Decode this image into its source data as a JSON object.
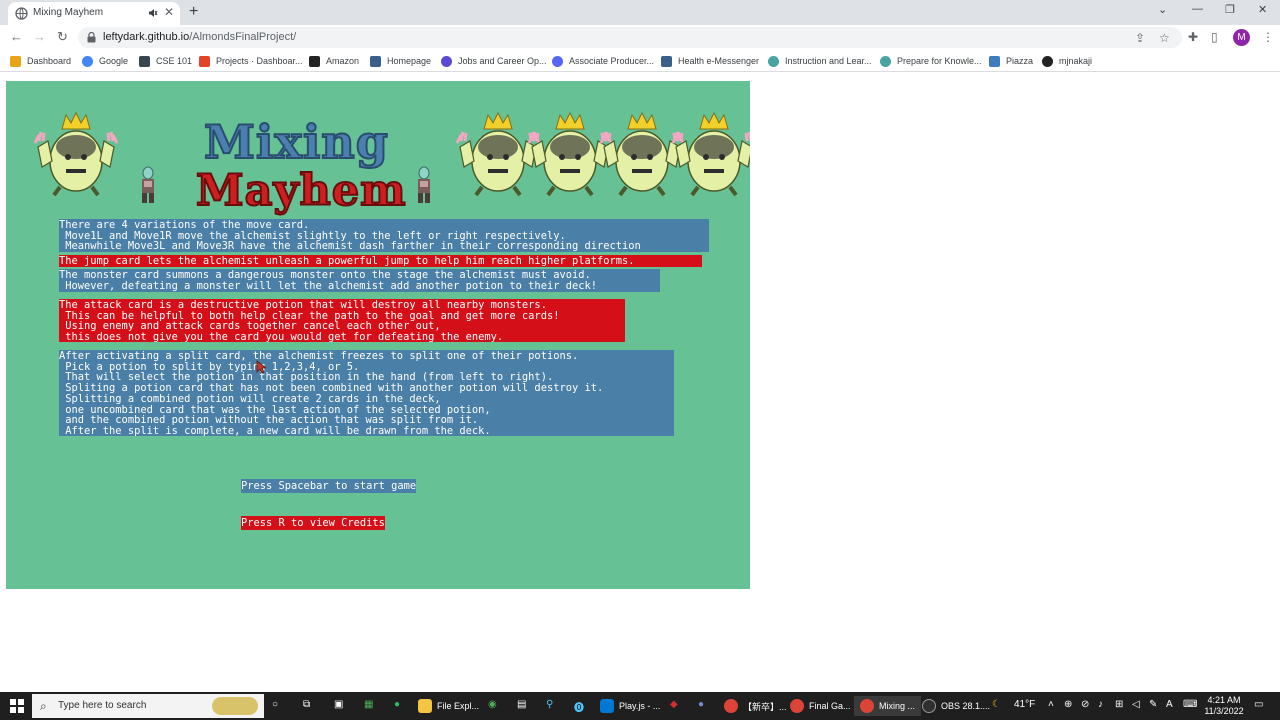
{
  "tab": {
    "title": "Mixing Mayhem",
    "close": "✕"
  },
  "newtab": "+",
  "window_controls": {
    "dropdown": "⌄",
    "minimize": "—",
    "maximize": "❐",
    "close": "✕"
  },
  "address": {
    "domain": "leftydark.github.io",
    "path": "/AlmondsFinalProject/"
  },
  "bookmarks": [
    {
      "label": "Dashboard",
      "icon": "canvas-icon",
      "color": "#e8a316"
    },
    {
      "label": "Google",
      "icon": "google-icon",
      "color": "#4285f4"
    },
    {
      "label": "CSE 101",
      "icon": "cse-icon",
      "color": "#37474f"
    },
    {
      "label": "Projects · Dashboar...",
      "icon": "gitlab-icon",
      "color": "#e24329"
    },
    {
      "label": "Amazon",
      "icon": "amazon-icon",
      "color": "#222222"
    },
    {
      "label": "Homepage",
      "icon": "homepage-icon",
      "color": "#3a5f8a"
    },
    {
      "label": "Jobs and Career Op...",
      "icon": "handshake-icon",
      "color": "#5b4ad6"
    },
    {
      "label": "Associate Producer...",
      "icon": "discord-icon",
      "color": "#5865f2"
    },
    {
      "label": "Health e-Messenger",
      "icon": "health-icon",
      "color": "#3a5f8a"
    },
    {
      "label": "Instruction and Lear...",
      "icon": "globe-icon",
      "color": "#4aa3a3"
    },
    {
      "label": "Prepare for Knowle...",
      "icon": "globe-icon",
      "color": "#4aa3a3"
    },
    {
      "label": "Piazza",
      "icon": "piazza-icon",
      "color": "#3e7bbf"
    },
    {
      "label": "mjnakaji",
      "icon": "github-icon",
      "color": "#222222"
    }
  ],
  "game": {
    "logo_top": "Mixing",
    "logo_bottom": "Mayhem",
    "move_block": "There are 4 variations of the move card.\n Move1L and Move1R move the alchemist slightly to the left or right respectively.\n Meanwhile Move3L and Move3R have the alchemist dash farther in their corresponding direction",
    "jump_block": "The jump card lets the alchemist unleash a powerful jump to help him reach higher platforms.",
    "monster_block": "The monster card summons a dangerous monster onto the stage the alchemist must avoid.\n However, defeating a monster will let the alchemist add another potion to their deck!",
    "attack_block": "The attack card is a destructive potion that will destroy all nearby monsters.\n This can be helpful to both help clear the path to the goal and get more cards!\n Using enemy and attack cards together cancel each other out,\n this does not give you the card you would get for defeating the enemy.",
    "split_block": "After activating a split card, the alchemist freezes to split one of their potions.\n Pick a potion to split by typing 1,2,3,4, or 5.\n That will select the potion in that position in the hand (from left to right).\n Spliting a potion card that has not been combined with another potion will destroy it.\n Splitting a combined potion will create 2 cards in the deck,\n one uncombined card that was the last action of the selected potion,\n and the combined potion without the action that was split from it.\n After the split is complete, a new card will be drawn from the deck.",
    "start_prompt": "Press Spacebar to start game",
    "credits_prompt": "Press R to view Credits",
    "colors": {
      "background": "#66c195",
      "blue_panel": "#4a7fa7",
      "red_panel": "#d50f18"
    }
  },
  "taskbar": {
    "search_placeholder": "Type here to search",
    "apps": [
      {
        "label": "File Expl...",
        "icon": "folder-icon",
        "color": "#f4c542"
      },
      {
        "label": "Play.js - ...",
        "icon": "vscode-icon",
        "color": "#0078d4"
      },
      {
        "label": "【新卒】...",
        "icon": "chrome-icon",
        "color": "#db4437"
      },
      {
        "label": "Final Ga...",
        "icon": "chrome-icon",
        "color": "#db4437"
      },
      {
        "label": "Mixing ...",
        "icon": "chrome-icon",
        "color": "#db4437"
      },
      {
        "label": "OBS 28.1....",
        "icon": "obs-icon",
        "color": "#302e31"
      }
    ],
    "weather": "41°F",
    "time": "4:21 AM",
    "date": "11/3/2022"
  }
}
